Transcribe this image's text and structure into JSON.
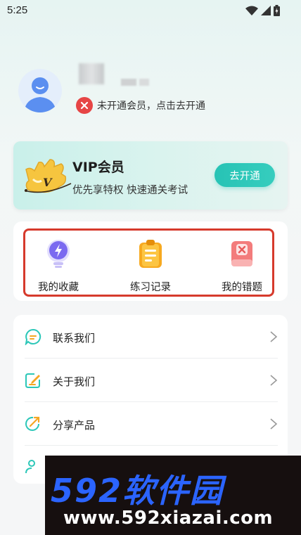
{
  "status_bar": {
    "time": "5:25"
  },
  "profile": {
    "membership_status": "未开通会员，点击去开通"
  },
  "vip_card": {
    "title": "VIP会员",
    "subtitle": "优先享特权 快速通关考试",
    "button_label": "去开通",
    "accent": "#2cc7b8"
  },
  "features": [
    {
      "label": "我的收藏",
      "icon": "bulb-icon"
    },
    {
      "label": "练习记录",
      "icon": "notepad-icon"
    },
    {
      "label": "我的错题",
      "icon": "wrong-book-icon"
    }
  ],
  "menu": [
    {
      "label": "联系我们",
      "icon": "chat-icon"
    },
    {
      "label": "关于我们",
      "icon": "edit-icon"
    },
    {
      "label": "分享产品",
      "icon": "share-icon"
    },
    {
      "label": "",
      "icon": "user-icon"
    }
  ],
  "watermark": {
    "logo_digits": "592",
    "logo_text": "软件园",
    "url": "www.592xiazai.com"
  }
}
